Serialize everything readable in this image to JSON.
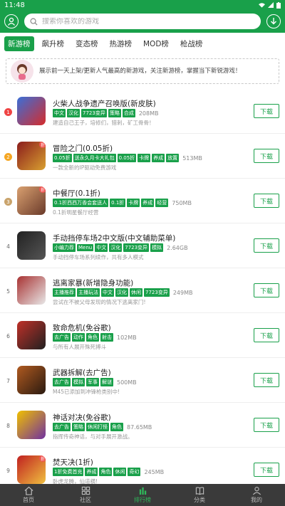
{
  "status": {
    "time": "11:48"
  },
  "search": {
    "placeholder": "搜索你喜欢的游戏"
  },
  "tabs": [
    {
      "label": "新游榜",
      "active": true
    },
    {
      "label": "飙升榜",
      "active": false
    },
    {
      "label": "变态榜",
      "active": false
    },
    {
      "label": "热游榜",
      "active": false
    },
    {
      "label": "MOD榜",
      "active": false
    },
    {
      "label": "枪战榜",
      "active": false
    }
  ],
  "intro": {
    "text": "展示前一天上架/更新人气最高的新游戏，关注新游榜，掌握当下新锐游戏！"
  },
  "download_label": "下载",
  "games": [
    {
      "rank": "1",
      "title": "火柴人战争遗产召唤版(新皮肤)",
      "tags": [
        "中文",
        "汉化",
        "7723变异",
        "策略",
        "合成"
      ],
      "size": "208MB",
      "desc": "建造自己王子，培修们，猎刺，矿工骨骨！",
      "badge": "",
      "colors": [
        "#3a6fd8",
        "#d62b2b"
      ]
    },
    {
      "rank": "2",
      "title": "冒险之门(0.05折)",
      "tags": [
        "0.05折",
        "送永久月卡大礼包",
        "0.05折",
        "卡牌",
        "养成",
        "放置"
      ],
      "size": "513MB",
      "desc": "一款全新的IP驱动免费游戏",
      "badge": "折",
      "colors": [
        "#8b1c1c",
        "#d8a030"
      ]
    },
    {
      "rank": "3",
      "title": "中餐厅(0.1折)",
      "tags": [
        "0.1折西西万香会套送人",
        "0.1折",
        "卡牌",
        "养成",
        "经营"
      ],
      "size": "750MB",
      "desc": "0.1折明星餐厅经营",
      "badge": "折",
      "colors": [
        "#d9a070",
        "#6a3a2a"
      ]
    },
    {
      "rank": "4",
      "title": "手动挡停车场2中文版(中文辅助菜单)",
      "tags": [
        "小编力荐",
        "Menu",
        "中文",
        "汉化",
        "7723变异",
        "模拟"
      ],
      "size": "2.64GB",
      "desc": "手动挡停车场系列续作，共有多人模式",
      "badge": "",
      "colors": [
        "#222",
        "#555"
      ]
    },
    {
      "rank": "5",
      "title": "逃离家暴(新增隐身功能)",
      "tags": [
        "主播推荐",
        "主播玩法",
        "中文",
        "汉化",
        "休闲",
        "7723变异"
      ],
      "size": "249MB",
      "desc": "尝试在不被父母发现的情况下逃离家门!",
      "badge": "",
      "colors": [
        "#a83232",
        "#e8e8e8"
      ]
    },
    {
      "rank": "6",
      "title": "致命危机(免谷歌)",
      "tags": [
        "去广告",
        "动作",
        "角色",
        "射击"
      ],
      "size": "102MB",
      "desc": "与所有人展开殊死搏斗",
      "badge": "",
      "colors": [
        "#c03028",
        "#202020"
      ]
    },
    {
      "rank": "7",
      "title": "武器拆解(去广告)",
      "tags": [
        "去广告",
        "模拟",
        "军事",
        "解谜"
      ],
      "size": "500MB",
      "desc": "M45已添加到冲锋枪类别中!",
      "badge": "",
      "colors": [
        "#b05a20",
        "#2a1a10"
      ]
    },
    {
      "rank": "8",
      "title": "神话对决(免谷歌)",
      "tags": [
        "去广告",
        "策略",
        "休闲打怪",
        "角色"
      ],
      "size": "87.65MB",
      "desc": "指挥传奇神话，与对手展开激战。",
      "badge": "",
      "colors": [
        "#f0c000",
        "#7030a0"
      ]
    },
    {
      "rank": "9",
      "title": "焚天决(1折)",
      "tags": [
        "1折免费首充",
        "养成",
        "角色",
        "休闲",
        "奇幻"
      ],
      "size": "245MB",
      "desc": "卧虎龙腾，仙道横!",
      "badge": "折",
      "colors": [
        "#c02020",
        "#f0c040"
      ]
    }
  ],
  "nav": [
    {
      "label": "首页",
      "icon": "home-icon",
      "active": false
    },
    {
      "label": "社区",
      "icon": "grid-icon",
      "active": false
    },
    {
      "label": "排行榜",
      "icon": "chart-icon",
      "active": true
    },
    {
      "label": "分类",
      "icon": "book-icon",
      "active": false
    },
    {
      "label": "我的",
      "icon": "user-icon",
      "active": false
    }
  ],
  "colors": {
    "accent": "#19a04a",
    "navbar": "#3a3a3a",
    "rank1": "#ef4444",
    "rank2": "#f5a623",
    "rank3": "#c9a36b"
  }
}
